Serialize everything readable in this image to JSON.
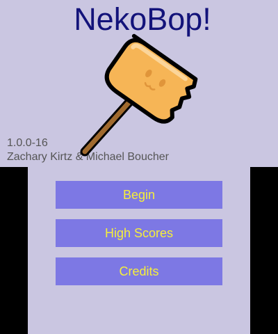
{
  "top_screen": {
    "title": "NekoBop!",
    "version": "1.0.0-16",
    "authors": "Zachary Kirtz & Michael Boucher",
    "hammer_icon": "mallet-icon"
  },
  "menu": {
    "begin_label": "Begin",
    "high_scores_label": "High Scores",
    "credits_label": "Credits"
  },
  "colors": {
    "screen_bg": "#cac6e1",
    "title": "#13137a",
    "button_bg": "#7d78e4",
    "button_text": "#f6ef3a",
    "mallet_head": "#f6b556"
  }
}
